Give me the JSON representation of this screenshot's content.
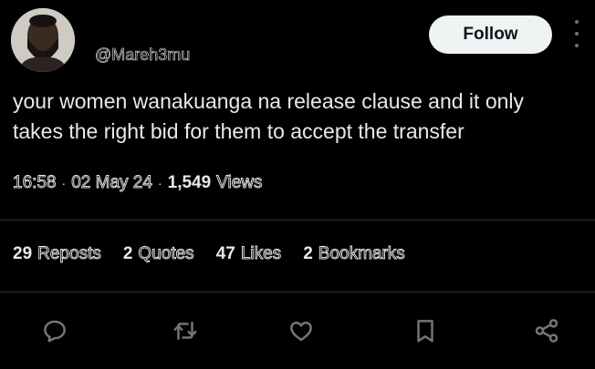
{
  "user": {
    "handle": "@Mareh3mu"
  },
  "follow_label": "Follow",
  "tweet": {
    "text": "your women wanakuanga na release clause and it only\ntakes the right bid for them to accept the transfer"
  },
  "meta": {
    "time": "16:58",
    "date": "02 May 24",
    "views_count": "1,549",
    "views_label": "Views"
  },
  "stats": {
    "reposts": {
      "count": "29",
      "label": "Reposts"
    },
    "quotes": {
      "count": "2",
      "label": "Quotes"
    },
    "likes": {
      "count": "47",
      "label": "Likes"
    },
    "bookmarks": {
      "count": "2",
      "label": "Bookmarks"
    }
  },
  "icons": [
    "reply-icon",
    "repost-icon",
    "like-icon",
    "bookmark-icon",
    "share-icon"
  ],
  "colors": {
    "background": "#000000",
    "text": "#e7e9ea",
    "muted": "#71767b",
    "divider": "#2f3336"
  }
}
